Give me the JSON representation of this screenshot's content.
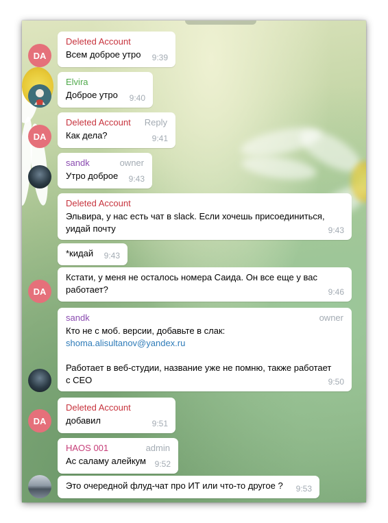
{
  "avatar_initials": "DA",
  "messages": [
    {
      "sender": "Deleted Account",
      "text": "Всем доброе утро",
      "time": "9:39"
    },
    {
      "sender": "Elvira",
      "text": "Доброе утро",
      "time": "9:40"
    },
    {
      "sender": "Deleted Account",
      "badge": "Reply",
      "text": "Как дела?",
      "time": "9:41"
    },
    {
      "sender": "sandk",
      "badge": "owner",
      "text": "Утро доброе",
      "time": "9:43"
    },
    {
      "sender": "Deleted Account",
      "text_lines": [
        "Эльвира, у нас есть чат в slack. Если хочешь присоединиться,",
        "уидай почту"
      ],
      "time": "9:43"
    },
    {
      "text": "*кидай",
      "time": "9:43"
    },
    {
      "text_lines": [
        "Кстати, у меня не осталось номера Саида. Он все еще у вас",
        "работает?"
      ],
      "time": "9:46"
    },
    {
      "sender": "sandk",
      "badge": "owner",
      "line1": "Кто не с моб. версии, добавьте в слак:",
      "link": "shoma.alisultanov@yandex.ru",
      "text_lines": [
        "Работает в веб-студии, название уже не помню, также работает",
        "с CEO"
      ],
      "time": "9:50"
    },
    {
      "sender": "Deleted Account",
      "text": "добавил",
      "time": "9:51"
    },
    {
      "sender": "HAOS 001",
      "badge": "admin",
      "text": "Ас саламу алейкум",
      "time": "9:52"
    },
    {
      "text": "Это очередной флуд-чат про ИТ или что-то другое ?",
      "time": "9:53"
    }
  ],
  "colors": {
    "deleted": "#c7333d",
    "elvira": "#4ea94a",
    "sandk": "#8a4bb0",
    "haos": "#c63d78",
    "da_avatar": "#e5707a"
  }
}
